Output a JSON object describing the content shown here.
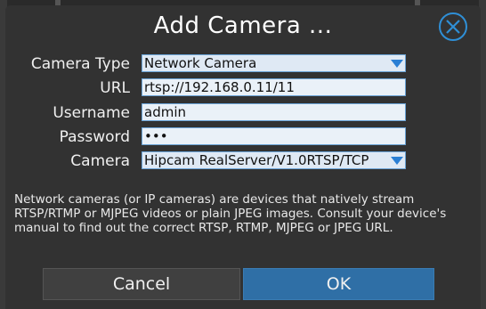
{
  "dialog": {
    "title": "Add Camera ...",
    "close_icon": "close-icon",
    "fields": {
      "camera_type": {
        "label": "Camera Type",
        "value": "Network Camera"
      },
      "url": {
        "label": "URL",
        "value": "rtsp://192.168.0.11/11"
      },
      "username": {
        "label": "Username",
        "value": "admin"
      },
      "password": {
        "label": "Password",
        "value": "•••"
      },
      "camera": {
        "label": "Camera",
        "value": "Hipcam RealServer/V1.0RTSP/TCP"
      }
    },
    "description": "Network cameras (or IP cameras) are devices that natively stream RTSP/RTMP or MJPEG videos or plain JPEG images. Consult your device's manual to find out the correct RTSP, RTMP, MJPEG or JPEG URL.",
    "buttons": {
      "cancel": "Cancel",
      "ok": "OK"
    }
  },
  "colors": {
    "accent": "#2f8fd6",
    "ok_button": "#2f6fa6",
    "background": "#323232"
  }
}
